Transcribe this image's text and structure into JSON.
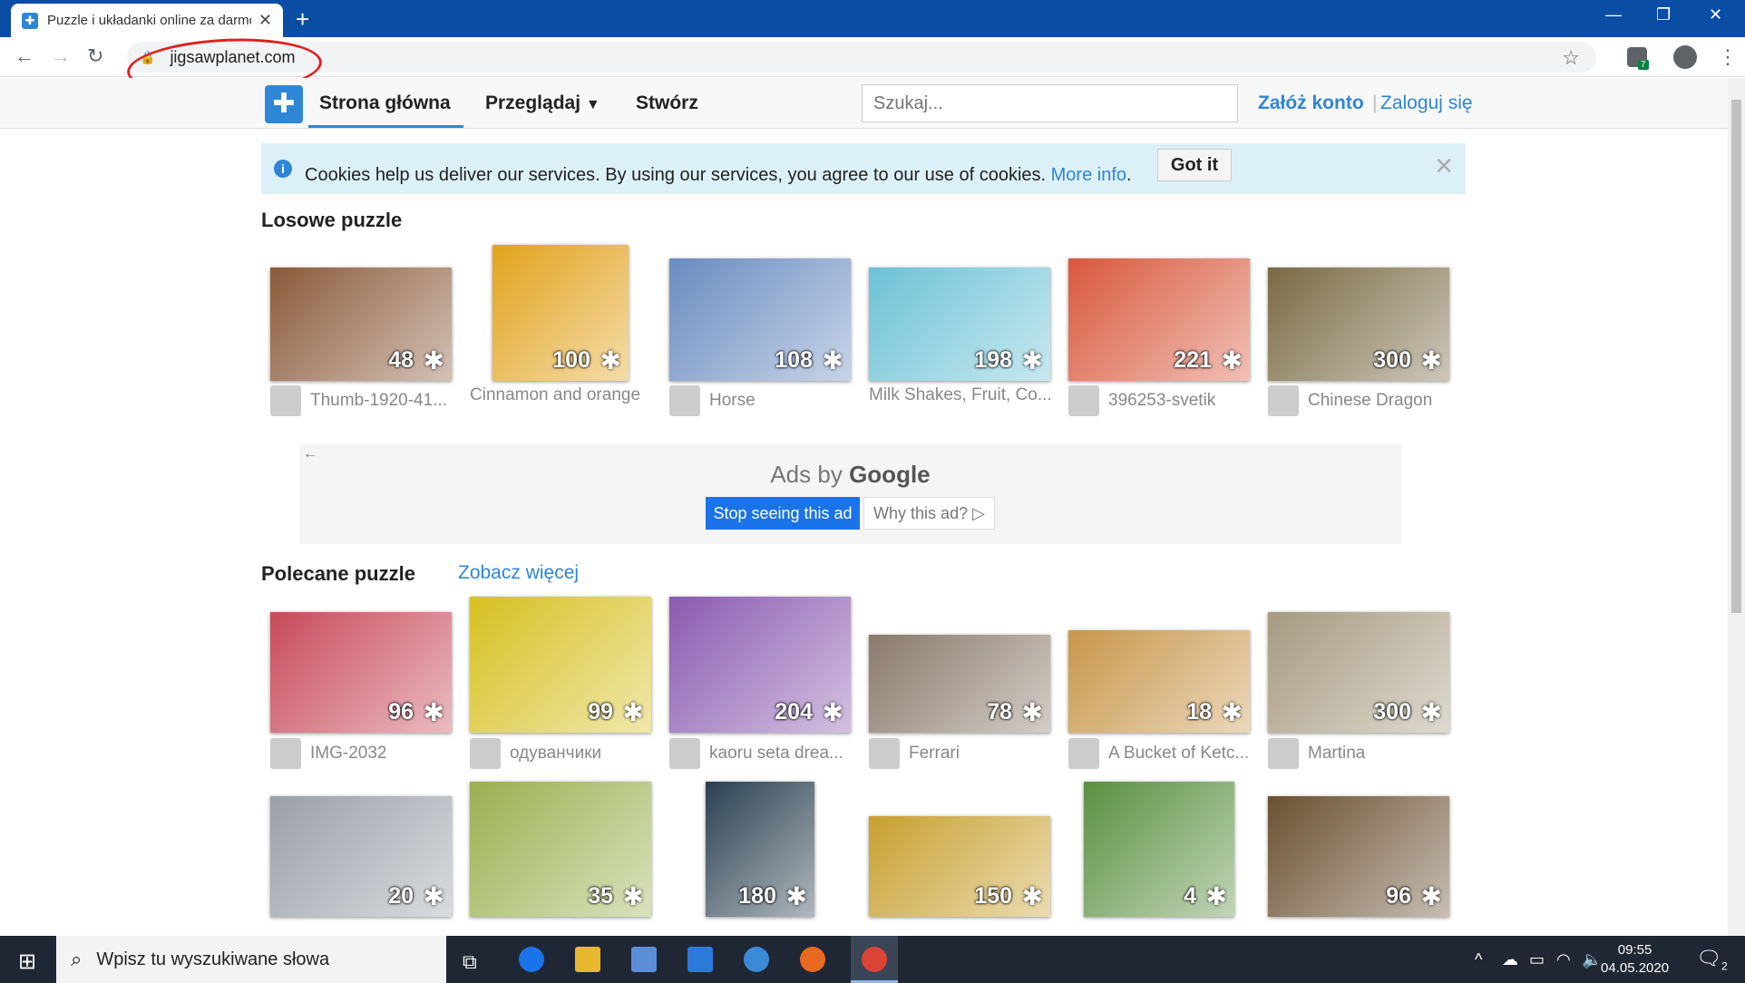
{
  "browser": {
    "tab_title": "Puzzle i układanki online za darmo",
    "url": "jigsawplanet.com",
    "extension_badge": "7"
  },
  "site": {
    "nav": {
      "home": "Strona główna",
      "browse": "Przeglądaj",
      "create": "Stwórz"
    },
    "search_placeholder": "Szukaj...",
    "signup": "Załóż konto",
    "login": "Zaloguj się"
  },
  "cookie": {
    "text": "Cookies help us deliver our services. By using our services, you agree to our use of cookies.",
    "link": "More info",
    "button": "Got it"
  },
  "sections": {
    "random_title": "Losowe puzzle",
    "featured_title": "Polecane puzzle",
    "see_more": "Zobacz więcej"
  },
  "random_puzzles": [
    {
      "pieces": "48",
      "name": "Thumb-1920-41...",
      "color": "#8a5a3a"
    },
    {
      "pieces": "100",
      "name": "Cinnamon and orange",
      "color": "#e2a21c"
    },
    {
      "pieces": "108",
      "name": "Horse",
      "color": "#6a8cc0"
    },
    {
      "pieces": "198",
      "name": "Milk Shakes, Fruit, Co...",
      "color": "#6cc2d6"
    },
    {
      "pieces": "221",
      "name": "396253-svetik",
      "color": "#d8583c"
    },
    {
      "pieces": "300",
      "name": "Chinese Dragon",
      "color": "#7a6a44"
    }
  ],
  "ad": {
    "title_prefix": "Ads by",
    "title_brand": "Google",
    "stop": "Stop seeing this ad",
    "why": "Why this ad? ▷"
  },
  "featured_puzzles": [
    {
      "pieces": "96",
      "name": "IMG-2032",
      "color": "#c84a5a"
    },
    {
      "pieces": "99",
      "name": "одуванчики",
      "color": "#d6c020"
    },
    {
      "pieces": "204",
      "name": "kaoru seta drea...",
      "color": "#8a5ab0"
    },
    {
      "pieces": "78",
      "name": "Ferrari",
      "color": "#8a7a6a"
    },
    {
      "pieces": "18",
      "name": "A Bucket of Ketc...",
      "color": "#c8964a"
    },
    {
      "pieces": "300",
      "name": "Martina",
      "color": "#a69a80"
    }
  ],
  "more_puzzles": [
    {
      "pieces": "20",
      "color": "#9aa0a8"
    },
    {
      "pieces": "35",
      "color": "#9ab050"
    },
    {
      "pieces": "180",
      "color": "#2a4050"
    },
    {
      "pieces": "150",
      "color": "#c8a030"
    },
    {
      "pieces": "4",
      "color": "#5a9040"
    },
    {
      "pieces": "96",
      "color": "#6a5030"
    }
  ],
  "taskbar": {
    "search": "Wpisz tu wyszukiwane słowa",
    "time": "09:55",
    "date": "04.05.2020",
    "notifications": "2"
  }
}
